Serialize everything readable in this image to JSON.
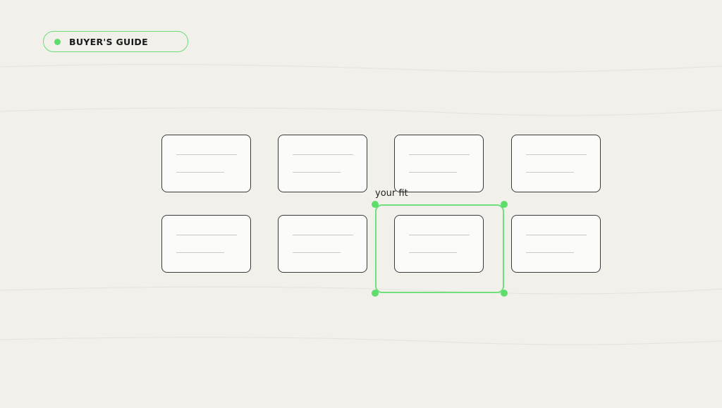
{
  "badge": {
    "label": "BUYER'S GUIDE",
    "dot_color": "#5fdd6c",
    "border_color": "#6ddc79"
  },
  "cards": [
    {
      "id": "card-1",
      "row": 1,
      "col": 1
    },
    {
      "id": "card-2",
      "row": 1,
      "col": 2
    },
    {
      "id": "card-3",
      "row": 1,
      "col": 3
    },
    {
      "id": "card-4",
      "row": 1,
      "col": 4
    },
    {
      "id": "card-5",
      "row": 2,
      "col": 1
    },
    {
      "id": "card-6",
      "row": 2,
      "col": 2
    },
    {
      "id": "card-7",
      "row": 2,
      "col": 3,
      "selected": true
    },
    {
      "id": "card-8",
      "row": 2,
      "col": 4
    }
  ],
  "selection": {
    "label": "your fit",
    "color": "#6fe07b"
  },
  "colors": {
    "background": "#f1f0eb",
    "card_border": "#3a3a3a",
    "accent": "#5fdd6c"
  }
}
